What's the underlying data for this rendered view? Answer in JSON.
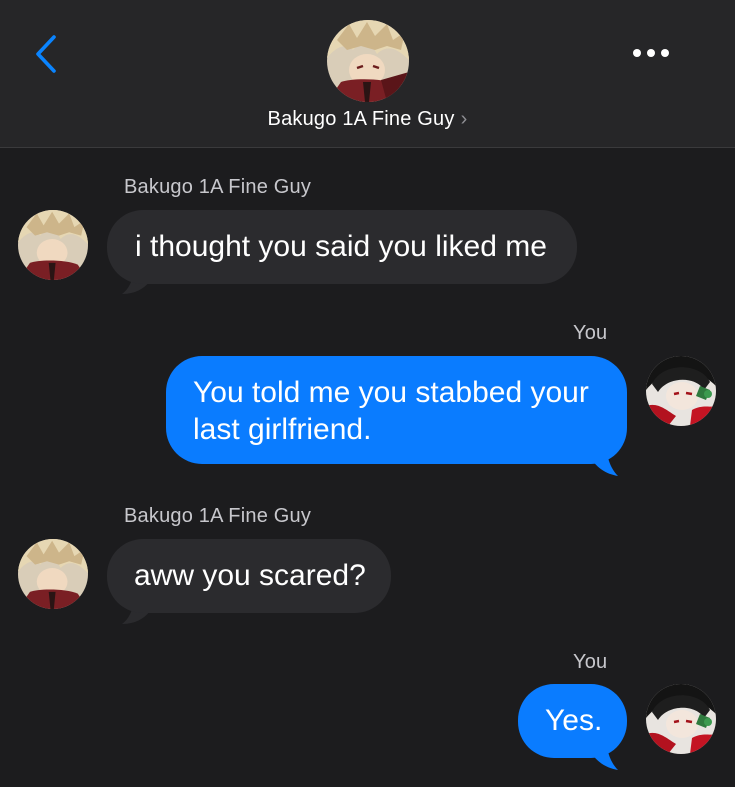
{
  "header": {
    "contact_name": "Bakugo 1A Fine Guy",
    "chevron": "›",
    "back_icon": "chevron-left-icon",
    "more_icon": "ellipsis-icon",
    "avatar": "contact-avatar"
  },
  "colors": {
    "background": "#1c1c1e",
    "header_background": "#262628",
    "incoming_bubble": "#2b2b2e",
    "outgoing_bubble": "#0a7cff",
    "accent": "#0a84ff"
  },
  "messages": [
    {
      "direction": "incoming",
      "sender": "Bakugo 1A Fine Guy",
      "lines": [
        "i thought you said you liked me"
      ]
    },
    {
      "direction": "outgoing",
      "sender": "You",
      "lines": [
        "You told me you stabbed your",
        "last girlfriend."
      ]
    },
    {
      "direction": "incoming",
      "sender": "Bakugo 1A Fine Guy",
      "lines": [
        "aww you scared?"
      ]
    },
    {
      "direction": "outgoing",
      "sender": "You",
      "lines": [
        "Yes."
      ]
    }
  ]
}
